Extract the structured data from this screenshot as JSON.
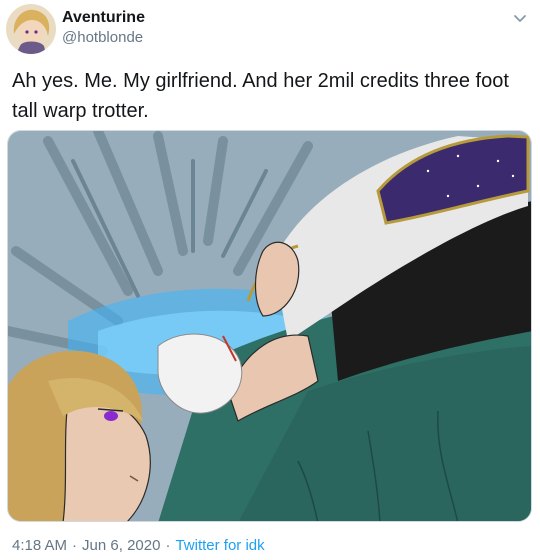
{
  "author": {
    "display_name": "Aventurine",
    "handle": "@hotblonde",
    "avatar_icon": "avatar-portrait"
  },
  "menu": {
    "icon": "chevron-down-icon"
  },
  "tweet": {
    "text": "Ah yes. Me. My girlfriend. And her 2mil credits three foot tall warp trotter."
  },
  "media": {
    "kind": "illustration"
  },
  "footer": {
    "time": "4:18 AM",
    "separator": "·",
    "date": "Jun 6, 2020",
    "source": "Twitter for idk"
  },
  "colors": {
    "accent": "#1da1f2",
    "secondary_text": "#657786",
    "primary_text": "#14171a"
  }
}
